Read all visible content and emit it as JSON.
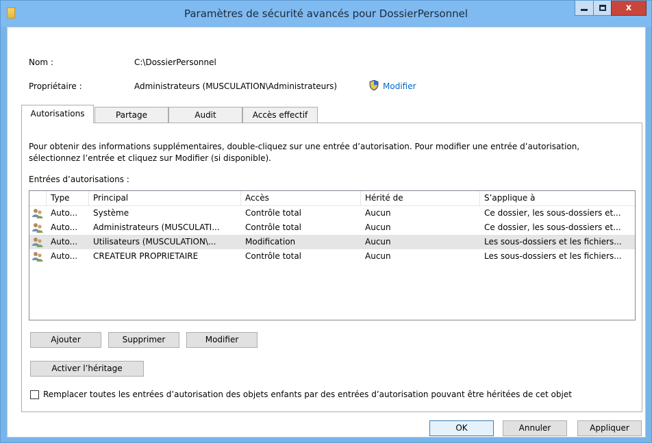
{
  "window": {
    "title": "Paramètres de sécurité avancés pour DossierPersonnel",
    "minimize_glyph": "",
    "close_glyph": "x"
  },
  "info": {
    "name_label": "Nom :",
    "name_value": "C:\\DossierPersonnel",
    "owner_label": "Propriétaire :",
    "owner_value": "Administrateurs (MUSCULATION\\Administrateurs)",
    "modify_link": "Modifier"
  },
  "tabs": [
    {
      "label": "Autorisations",
      "active": true
    },
    {
      "label": "Partage",
      "active": false
    },
    {
      "label": "Audit",
      "active": false
    },
    {
      "label": "Accès effectif",
      "active": false
    }
  ],
  "panel": {
    "description_line1": "Pour obtenir des informations supplémentaires, double-cliquez sur une entrée d’autorisation. Pour modifier une entrée d’autorisation,",
    "description_line2": "sélectionnez l’entrée et cliquez sur Modifier (si disponible).",
    "entries_label": "Entrées d’autorisations :"
  },
  "table": {
    "columns": [
      "Type",
      "Principal",
      "Accès",
      "Hérité de",
      "S’applique à"
    ],
    "rows": [
      [
        "Auto...",
        "Système",
        "Contrôle total",
        "Aucun",
        "Ce dossier, les sous-dossiers et..."
      ],
      [
        "Auto...",
        "Administrateurs (MUSCULATI...",
        "Contrôle total",
        "Aucun",
        "Ce dossier, les sous-dossiers et..."
      ],
      [
        "Auto...",
        "Utilisateurs (MUSCULATION\\...",
        "Modification",
        "Aucun",
        "Les sous-dossiers et les fichiers..."
      ],
      [
        "Auto...",
        "CREATEUR PROPRIETAIRE",
        "Contrôle total",
        "Aucun",
        "Les sous-dossiers et les fichiers..."
      ]
    ]
  },
  "buttons": {
    "add": "Ajouter",
    "remove": "Supprimer",
    "edit": "Modifier",
    "enable_inheritance": "Activer l’héritage",
    "ok": "OK",
    "cancel": "Annuler",
    "apply": "Appliquer"
  },
  "checkbox": {
    "label": "Remplacer toutes les entrées d’autorisation des objets enfants par des entrées d’autorisation pouvant être héritées de cet objet",
    "checked": false
  },
  "icons": {
    "app": "folder-icon",
    "owner_modify": "uac-shield-icon",
    "entry": "users-icon"
  },
  "colors": {
    "titlebar": "#7fbaf0",
    "close_button": "#c7463b",
    "link": "#0066cc",
    "highlight_row": "#e5e5e5"
  }
}
